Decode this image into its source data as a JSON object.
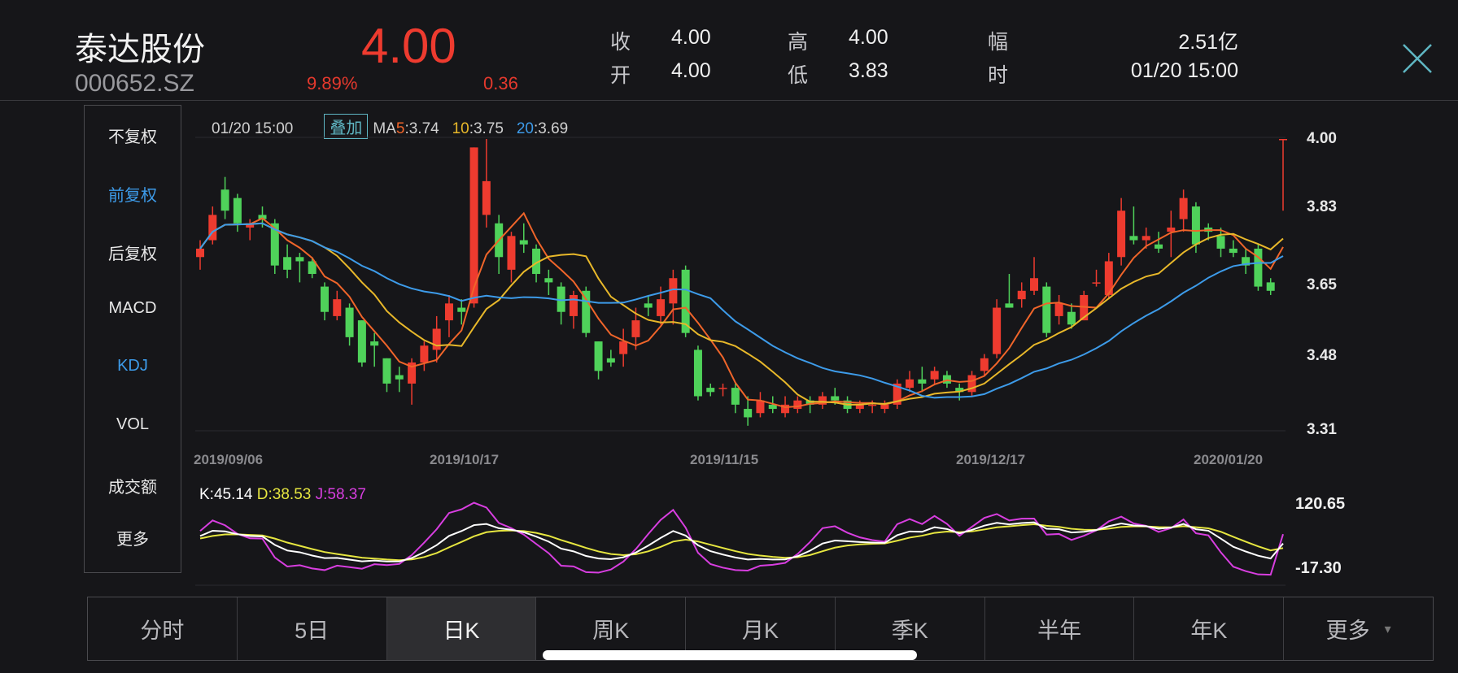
{
  "header": {
    "name": "泰达股份",
    "code": "000652.SZ",
    "price": "4.00",
    "change_pct": "9.89%",
    "change": "0.36",
    "stats": [
      {
        "label": "收",
        "value": "4.00"
      },
      {
        "label": "开",
        "value": "4.00"
      },
      {
        "label": "高",
        "value": "4.00"
      },
      {
        "label": "低",
        "value": "3.83"
      },
      {
        "label": "幅",
        "value": "2.51亿"
      },
      {
        "label": "时",
        "value": "01/20 15:00"
      }
    ]
  },
  "sidebar": {
    "items": [
      {
        "label": "不复权"
      },
      {
        "label": "前复权",
        "active": true
      },
      {
        "label": "后复权"
      },
      {
        "label": "MACD"
      },
      {
        "label": "KDJ",
        "active": true
      },
      {
        "label": "VOL"
      },
      {
        "label": "成交额"
      },
      {
        "label": "更多"
      }
    ]
  },
  "chart_top": {
    "time": "01/20 15:00",
    "overlay_label": "叠加",
    "ma_prefix": "MA",
    "ma5_key": "5",
    "ma5_val": ":3.74",
    "ma10_key": "10",
    "ma10_val": ":3.75",
    "ma20_key": "20",
    "ma20_val": ":3.69"
  },
  "colors": {
    "up": "#ee3b2f",
    "down": "#4fd25a",
    "ma5": "#f0652a",
    "ma10": "#e8b82a",
    "ma20": "#3d9be9",
    "k": "#ffffff",
    "d": "#e6e640",
    "j": "#d83ee0"
  },
  "chart_data": [
    {
      "type": "candlestick",
      "title": "日K",
      "ylim": [
        3.31,
        4.0
      ],
      "price_labels": [
        {
          "value": "4.00",
          "color": "#ee3b2f"
        },
        {
          "value": "3.83",
          "color": "#ee3b2f"
        },
        {
          "value": "3.65",
          "color": "#e8e8e8"
        },
        {
          "value": "3.48",
          "color": "#4fc159"
        },
        {
          "value": "3.31",
          "color": "#4fc159"
        }
      ],
      "date_labels": [
        {
          "label": "2019/09/06",
          "index": 0
        },
        {
          "label": "2019/10/17",
          "index": 21
        },
        {
          "label": "2019/11/15",
          "index": 41
        },
        {
          "label": "2019/12/17",
          "index": 63
        },
        {
          "label": "2020/01/20",
          "index": 87
        }
      ],
      "ohlc": [
        [
          3.72,
          3.74,
          3.76,
          3.69
        ],
        [
          3.76,
          3.82,
          3.84,
          3.75
        ],
        [
          3.88,
          3.83,
          3.91,
          3.81
        ],
        [
          3.86,
          3.8,
          3.87,
          3.78
        ],
        [
          3.79,
          3.8,
          3.81,
          3.76
        ],
        [
          3.82,
          3.81,
          3.84,
          3.79
        ],
        [
          3.8,
          3.7,
          3.81,
          3.68
        ],
        [
          3.72,
          3.69,
          3.75,
          3.67
        ],
        [
          3.72,
          3.71,
          3.73,
          3.66
        ],
        [
          3.71,
          3.68,
          3.72,
          3.67
        ],
        [
          3.65,
          3.59,
          3.66,
          3.57
        ],
        [
          3.58,
          3.62,
          3.64,
          3.57
        ],
        [
          3.6,
          3.53,
          3.61,
          3.51
        ],
        [
          3.57,
          3.47,
          3.57,
          3.46
        ],
        [
          3.52,
          3.51,
          3.54,
          3.46
        ],
        [
          3.48,
          3.42,
          3.48,
          3.4
        ],
        [
          3.44,
          3.43,
          3.46,
          3.4
        ],
        [
          3.42,
          3.47,
          3.48,
          3.37
        ],
        [
          3.47,
          3.51,
          3.52,
          3.45
        ],
        [
          3.5,
          3.55,
          3.58,
          3.47
        ],
        [
          3.57,
          3.61,
          3.63,
          3.53
        ],
        [
          3.6,
          3.59,
          3.62,
          3.56
        ],
        [
          3.61,
          3.98,
          3.98,
          3.6
        ],
        [
          3.82,
          3.9,
          4.0,
          3.79
        ],
        [
          3.8,
          3.72,
          3.82,
          3.68
        ],
        [
          3.69,
          3.77,
          3.78,
          3.66
        ],
        [
          3.76,
          3.75,
          3.8,
          3.73
        ],
        [
          3.74,
          3.68,
          3.75,
          3.66
        ],
        [
          3.67,
          3.66,
          3.69,
          3.63
        ],
        [
          3.65,
          3.59,
          3.66,
          3.56
        ],
        [
          3.58,
          3.63,
          3.64,
          3.55
        ],
        [
          3.64,
          3.54,
          3.65,
          3.53
        ],
        [
          3.52,
          3.45,
          3.52,
          3.43
        ],
        [
          3.48,
          3.47,
          3.5,
          3.46
        ],
        [
          3.49,
          3.52,
          3.55,
          3.46
        ],
        [
          3.53,
          3.57,
          3.6,
          3.5
        ],
        [
          3.61,
          3.6,
          3.63,
          3.58
        ],
        [
          3.58,
          3.62,
          3.65,
          3.56
        ],
        [
          3.61,
          3.67,
          3.69,
          3.56
        ],
        [
          3.69,
          3.54,
          3.7,
          3.53
        ],
        [
          3.5,
          3.39,
          3.51,
          3.38
        ],
        [
          3.41,
          3.4,
          3.42,
          3.39
        ],
        [
          3.41,
          3.41,
          3.42,
          3.39
        ],
        [
          3.41,
          3.37,
          3.42,
          3.35
        ],
        [
          3.36,
          3.34,
          3.39,
          3.32
        ],
        [
          3.35,
          3.38,
          3.4,
          3.34
        ],
        [
          3.37,
          3.36,
          3.39,
          3.35
        ],
        [
          3.35,
          3.37,
          3.39,
          3.34
        ],
        [
          3.36,
          3.38,
          3.39,
          3.35
        ],
        [
          3.38,
          3.37,
          3.39,
          3.35
        ],
        [
          3.37,
          3.39,
          3.4,
          3.36
        ],
        [
          3.39,
          3.38,
          3.41,
          3.37
        ],
        [
          3.38,
          3.36,
          3.39,
          3.35
        ],
        [
          3.36,
          3.37,
          3.38,
          3.35
        ],
        [
          3.37,
          3.37,
          3.38,
          3.35
        ],
        [
          3.36,
          3.37,
          3.38,
          3.35
        ],
        [
          3.37,
          3.42,
          3.43,
          3.36
        ],
        [
          3.41,
          3.43,
          3.45,
          3.4
        ],
        [
          3.43,
          3.42,
          3.46,
          3.4
        ],
        [
          3.43,
          3.45,
          3.46,
          3.42
        ],
        [
          3.44,
          3.42,
          3.45,
          3.41
        ],
        [
          3.41,
          3.4,
          3.42,
          3.38
        ],
        [
          3.4,
          3.44,
          3.45,
          3.39
        ],
        [
          3.45,
          3.48,
          3.49,
          3.44
        ],
        [
          3.49,
          3.6,
          3.62,
          3.48
        ],
        [
          3.61,
          3.6,
          3.68,
          3.6
        ],
        [
          3.62,
          3.64,
          3.66,
          3.6
        ],
        [
          3.64,
          3.67,
          3.72,
          3.63
        ],
        [
          3.65,
          3.54,
          3.66,
          3.53
        ],
        [
          3.58,
          3.61,
          3.63,
          3.56
        ],
        [
          3.59,
          3.56,
          3.61,
          3.55
        ],
        [
          3.57,
          3.63,
          3.64,
          3.57
        ],
        [
          3.66,
          3.66,
          3.69,
          3.65
        ],
        [
          3.63,
          3.71,
          3.73,
          3.62
        ],
        [
          3.72,
          3.83,
          3.86,
          3.7
        ],
        [
          3.77,
          3.76,
          3.84,
          3.75
        ],
        [
          3.76,
          3.77,
          3.79,
          3.74
        ],
        [
          3.75,
          3.74,
          3.78,
          3.73
        ],
        [
          3.78,
          3.79,
          3.83,
          3.72
        ],
        [
          3.81,
          3.86,
          3.88,
          3.78
        ],
        [
          3.84,
          3.75,
          3.85,
          3.73
        ],
        [
          3.79,
          3.78,
          3.8,
          3.76
        ],
        [
          3.77,
          3.74,
          3.79,
          3.72
        ],
        [
          3.74,
          3.73,
          3.76,
          3.72
        ],
        [
          3.72,
          3.7,
          3.74,
          3.68
        ],
        [
          3.74,
          3.65,
          3.75,
          3.64
        ],
        [
          3.66,
          3.64,
          3.67,
          3.63
        ],
        [
          4.0,
          4.0,
          4.0,
          3.83
        ]
      ],
      "ma_periods": [
        5,
        10,
        20
      ]
    },
    {
      "type": "line",
      "title": "KDJ",
      "k_label": "K:45.14",
      "d_label": "D:38.53",
      "j_label": "J:58.37",
      "ylim": [
        -17.3,
        120.65
      ],
      "max_label": "120.65",
      "min_label": "-17.30",
      "params": [
        9,
        3,
        3
      ]
    }
  ],
  "tabs": [
    {
      "label": "分时"
    },
    {
      "label": "5日"
    },
    {
      "label": "日K",
      "active": true
    },
    {
      "label": "周K"
    },
    {
      "label": "月K"
    },
    {
      "label": "季K"
    },
    {
      "label": "半年"
    },
    {
      "label": "年K"
    },
    {
      "label": "更多",
      "dropdown": "▾"
    }
  ]
}
